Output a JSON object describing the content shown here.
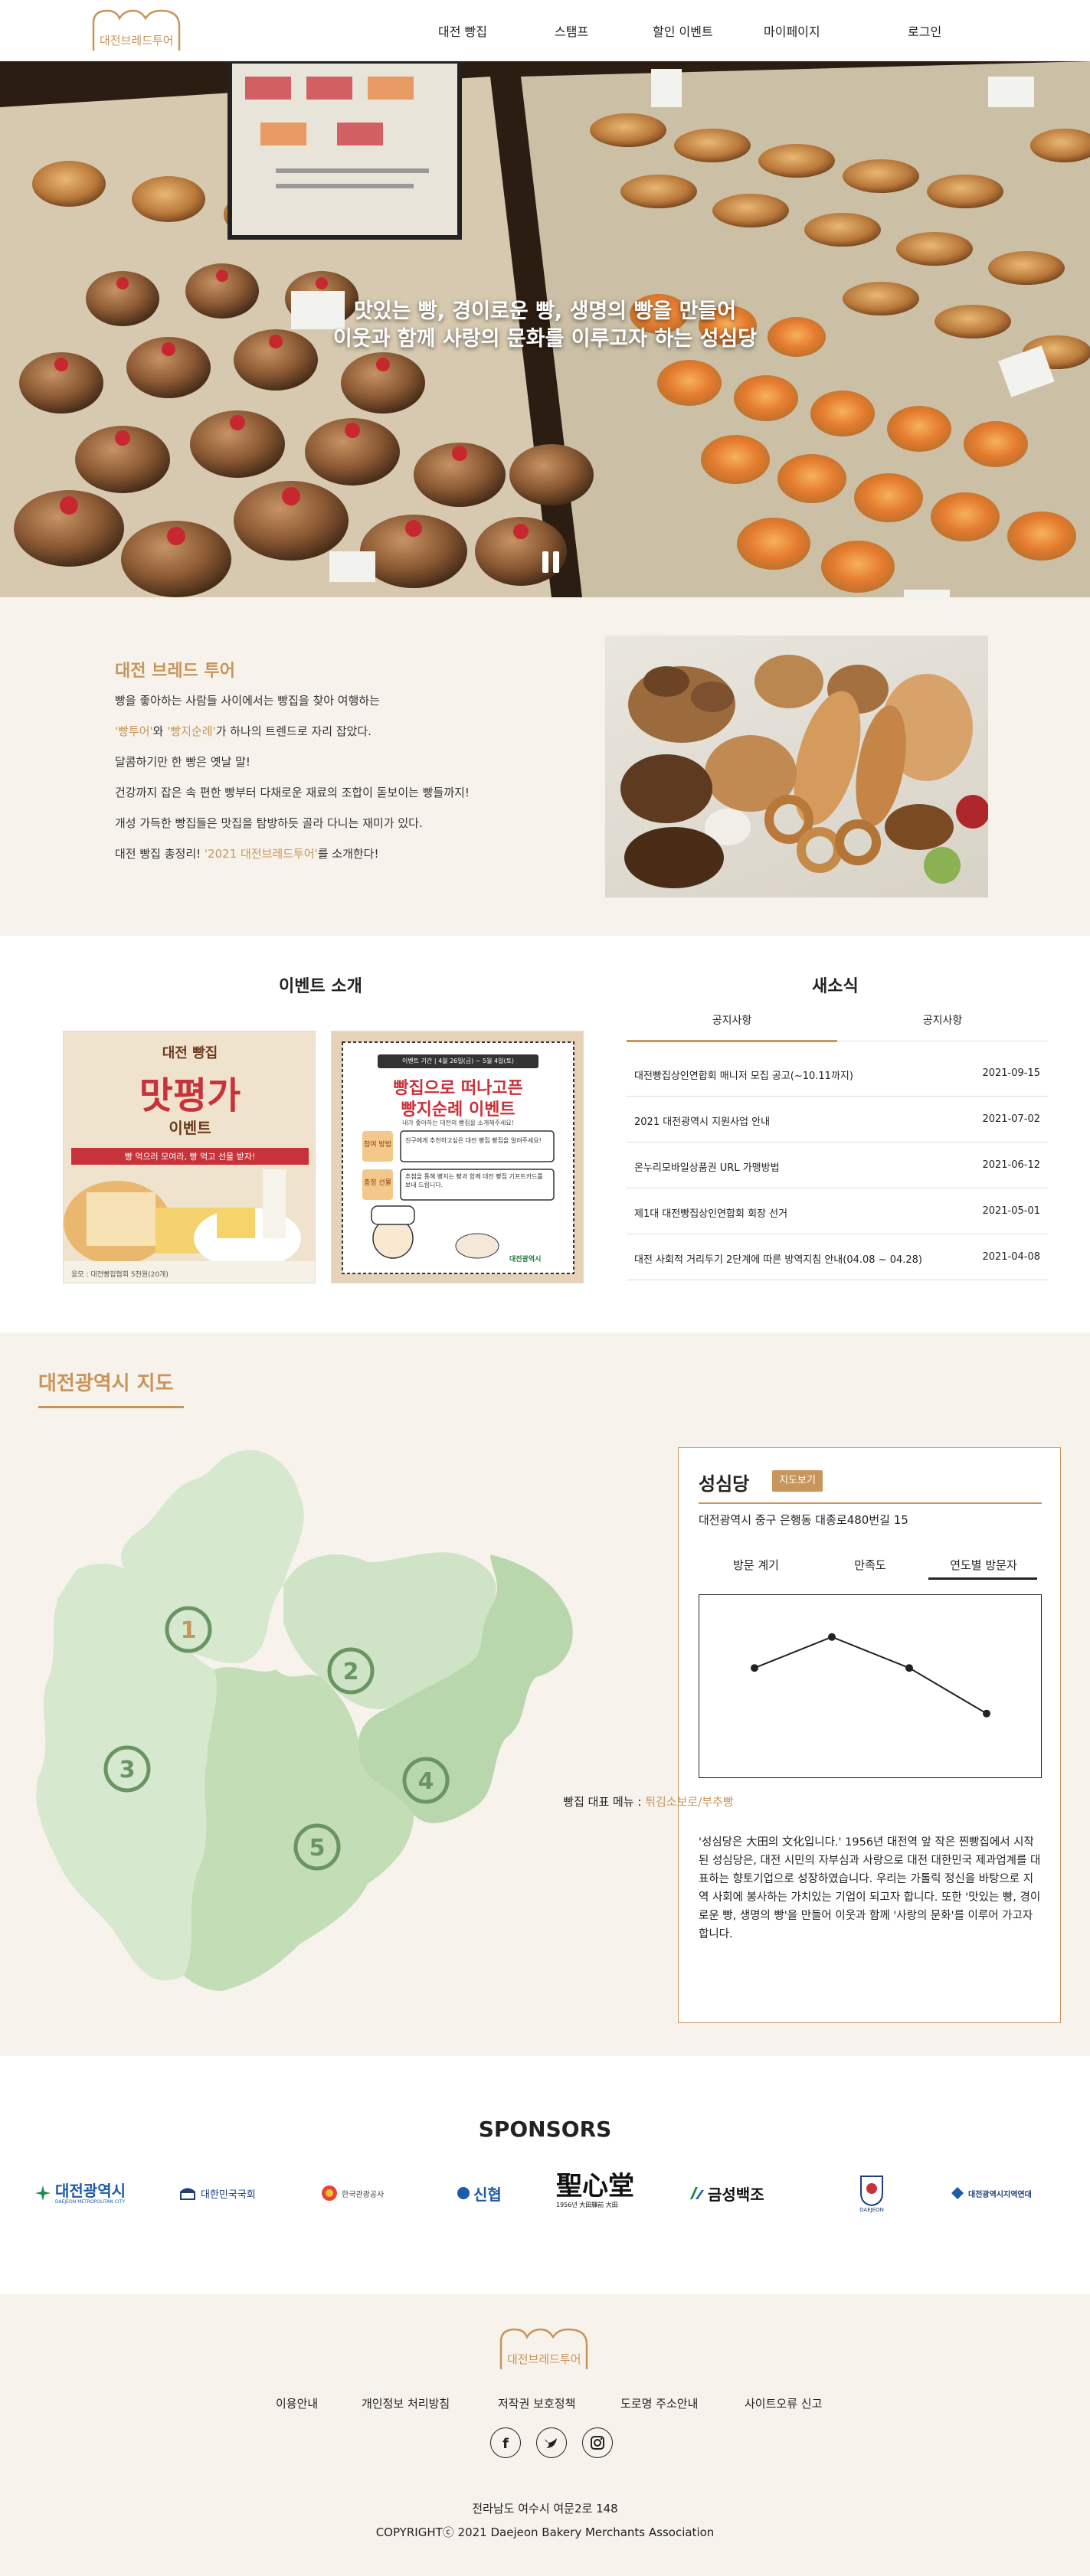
{
  "header": {
    "logo_text": "대전브레드투어",
    "nav": [
      "대전 빵집",
      "스탬프",
      "할인 이벤트",
      "마이페이지",
      "로그인"
    ]
  },
  "hero": {
    "line1": "맛있는 빵, 경이로운 빵, 생명의 빵을 만들어",
    "line2": "이웃과 함께 사랑의 문화를 이루고자 하는 성심당"
  },
  "intro": {
    "title": "대전 브레드 투어",
    "line1": "빵을 좋아하는 사람들 사이에서는 빵집을 찾아 여행하는",
    "line2_hl1": "'빵투어'",
    "line2_mid": "와 ",
    "line2_hl2": "'빵지순례'",
    "line2_end": "가 하나의 트렌드로 자리 잡았다.",
    "line3": "달콤하기만 한 빵은 옛날 말!",
    "line4": "건강까지 잡은 속 편한 빵부터 다채로운 재료의 조합이 돋보이는 빵들까지!",
    "line5": "개성 가득한 빵집들은 맛집을 탐방하듯 골라 다니는 재미가 있다.",
    "line6_start": "대전 빵집 총정리! ",
    "line6_hl": "'2021 대전브레드투어'",
    "line6_end": "를 소개한다!"
  },
  "events": {
    "title": "이벤트 소개",
    "card1": {
      "top": "대전 빵집",
      "main": "맛평가",
      "sub": "이벤트",
      "ribbon": "빵 먹으러 모여라, 빵 먹고 선물 받자!",
      "foot": "응모 : 대전빵집협회 5천원(20개)"
    },
    "card2": {
      "period": "이벤트 기간 | 4월 26일(금) ~ 5월 4일(토)",
      "main1": "빵집으로 떠나고픈",
      "main2": "빵지순례 이벤트",
      "sub": "내가 좋아하는 대전의 빵집을 소개해주세요!",
      "tag1": "참여 방법",
      "tag2": "증정 선물",
      "text1": "친구에게 추천하고싶은 대전 빵집 빵집을 알려주세요!",
      "text2": "추첨을 통해 빵지는 빵과 함께 대전 빵집 기프트카드를 보내 드립니다.",
      "logo": "대전광역시"
    }
  },
  "news": {
    "title": "새소식",
    "tabs": [
      "공지사항",
      "공지사항"
    ],
    "rows": [
      {
        "title": "대전빵집상인연합회 매니저 모집 공고(~10.11까지)",
        "date": "2021-09-15"
      },
      {
        "title": "2021 대전광역시 지원사업 안내",
        "date": "2021-07-02"
      },
      {
        "title": "온누리모바일상품권 URL 가맹방법",
        "date": "2021-06-12"
      },
      {
        "title": "제1대 대전빵집상인연합회 회장 선거",
        "date": "2021-05-01"
      },
      {
        "title": "대전 사회적 거리두기 2단계에 따른 방역지침 안내(04.08 ~ 04.28)",
        "date": "2021-04-08"
      }
    ]
  },
  "map": {
    "title": "대전광역시 지도",
    "markers": [
      "1",
      "2",
      "3",
      "4",
      "5"
    ]
  },
  "panel": {
    "name": "성심당",
    "btn": "지도보기",
    "address": "대전광역시 중구 은행동 대종로480번길 15",
    "tabs": [
      "방문 계기",
      "만족도",
      "연도별 방문자"
    ],
    "menu_label": "빵집 대표 메뉴 : ",
    "menu_value": "튀김소보로/부추빵",
    "desc": "'성심당은 大田의 文化입니다.' 1956년 대전역 앞 작은 찐빵집에서 시작된 성심당은, 대전 시민의 자부심과 사랑으로 대전 대한민국 제과업계를 대표하는 향토기업으로 성장하였습니다. 우리는 가톨릭 정신을 바탕으로 지역 사회에 봉사하는 가치있는 기업이 되고자 합니다. 또한 '맛있는 빵, 경이로운 빵, 생명의 빵'을 만들어 이웃과 함께 '사랑의 문화'를 이루어 가고자 합니다."
  },
  "chart_data": {
    "type": "line",
    "values": [
      60,
      77,
      60,
      35
    ],
    "title": "",
    "xlabel": "",
    "ylabel": ""
  },
  "sponsors": {
    "title": "SPONSORS",
    "items": [
      "대전광역시",
      "대한민국국회",
      "한국관광공사",
      "신협",
      "聖心堂",
      "금성백조",
      "DAEJEON",
      "대전광역시지역연대"
    ],
    "sub_daejeon": "DAEJEON METROPOLITAN CITY",
    "sub_sungsim": "1956년 大田驛前 大田"
  },
  "footer": {
    "logo_text": "대전브레드투어",
    "links": [
      "이용안내",
      "개인정보 처리방침",
      "저작권 보호정책",
      "도로명 주소안내",
      "사이트오류 신고"
    ],
    "address": "전라남도 여수시 여문2로 148",
    "copyright": "COPYRIGHTⓒ 2021 Daejeon Bakery Merchants Association"
  },
  "colors": {
    "accent": "#c8955b",
    "map_light": "#cfe3c6",
    "map_dark": "#b6d4aa",
    "marker": "#6a9563",
    "cream": "#f7f3ec"
  }
}
